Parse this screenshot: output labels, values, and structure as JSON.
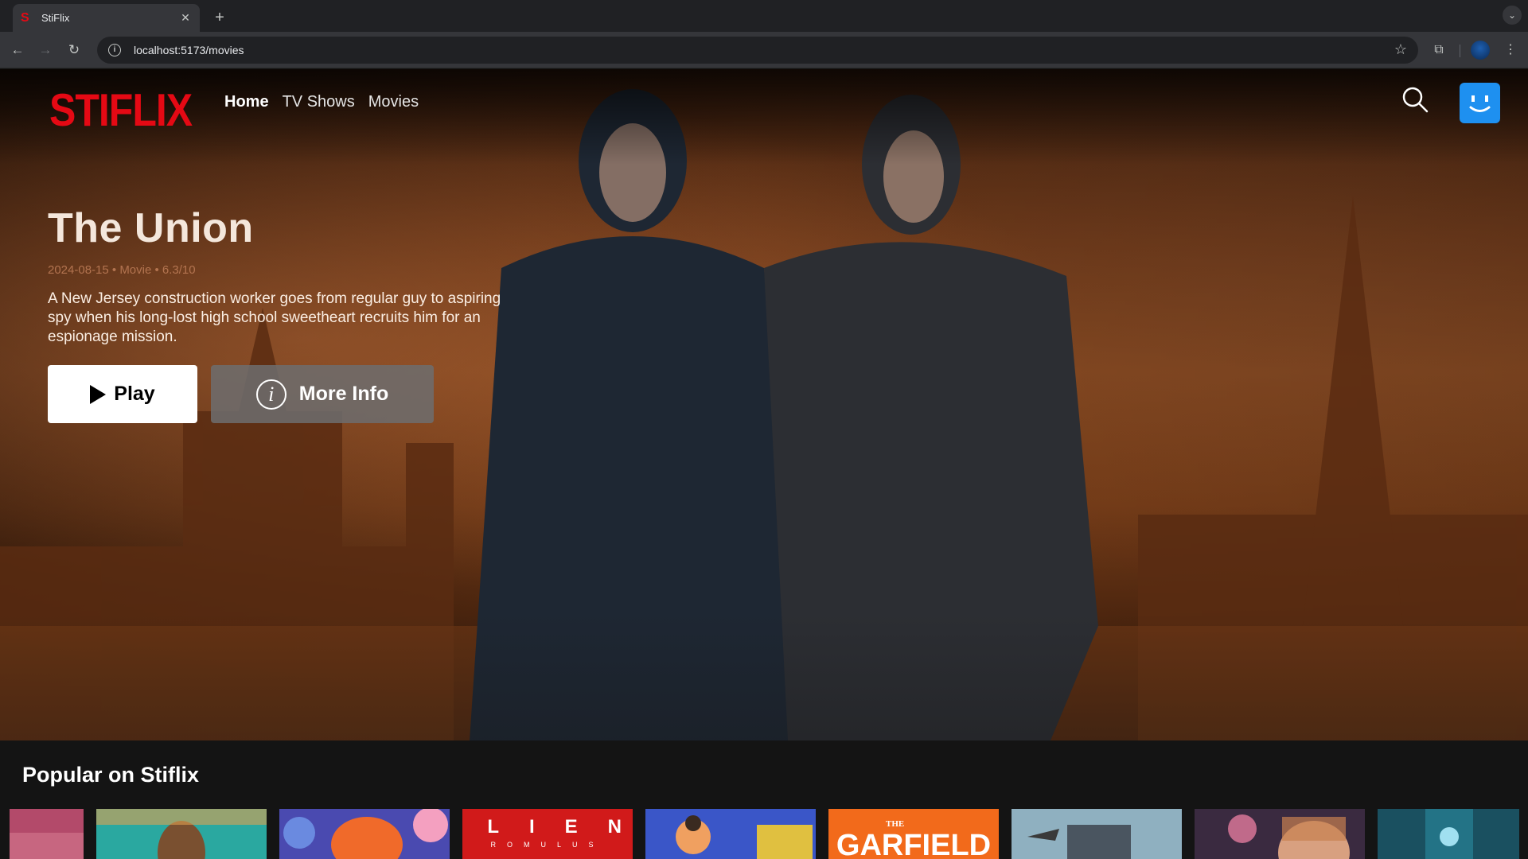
{
  "browser": {
    "tab_title": "StiFlix",
    "tab_favicon": "S",
    "url": "localhost:5173/movies"
  },
  "nav": {
    "logo": "STIFLIX",
    "links": [
      {
        "label": "Home",
        "active": true
      },
      {
        "label": "TV Shows",
        "active": false
      },
      {
        "label": "Movies",
        "active": false
      }
    ]
  },
  "hero": {
    "title": "The Union",
    "meta": "2024-08-15 • Movie • 6.3/10",
    "description": "A New Jersey construction worker goes from regular guy to aspiring spy when his long-lost high school sweetheart recruits him for an espionage mission.",
    "play_label": "Play",
    "info_label": "More Info",
    "info_icon": "i"
  },
  "row": {
    "title": "Popular on Stiflix",
    "posters": [
      {
        "label": "",
        "color": "#b34a6a"
      },
      {
        "label": "",
        "color": "#2aa8a0"
      },
      {
        "label": "",
        "color": "#4a4ab0"
      },
      {
        "label": "ALIEN",
        "sublabel": "ROMULUS",
        "color": "#d11a1a"
      },
      {
        "label": "",
        "color": "#3a56c8"
      },
      {
        "label": "GARFIELD",
        "sublabel": "THE",
        "color": "#f26a1b"
      },
      {
        "label": "",
        "color": "#8fb0c0"
      },
      {
        "label": "",
        "color": "#3a2a40"
      },
      {
        "label": "",
        "color": "#1a5060"
      }
    ]
  },
  "colors": {
    "brand": "#e50914",
    "avatar": "#1e90f0"
  }
}
